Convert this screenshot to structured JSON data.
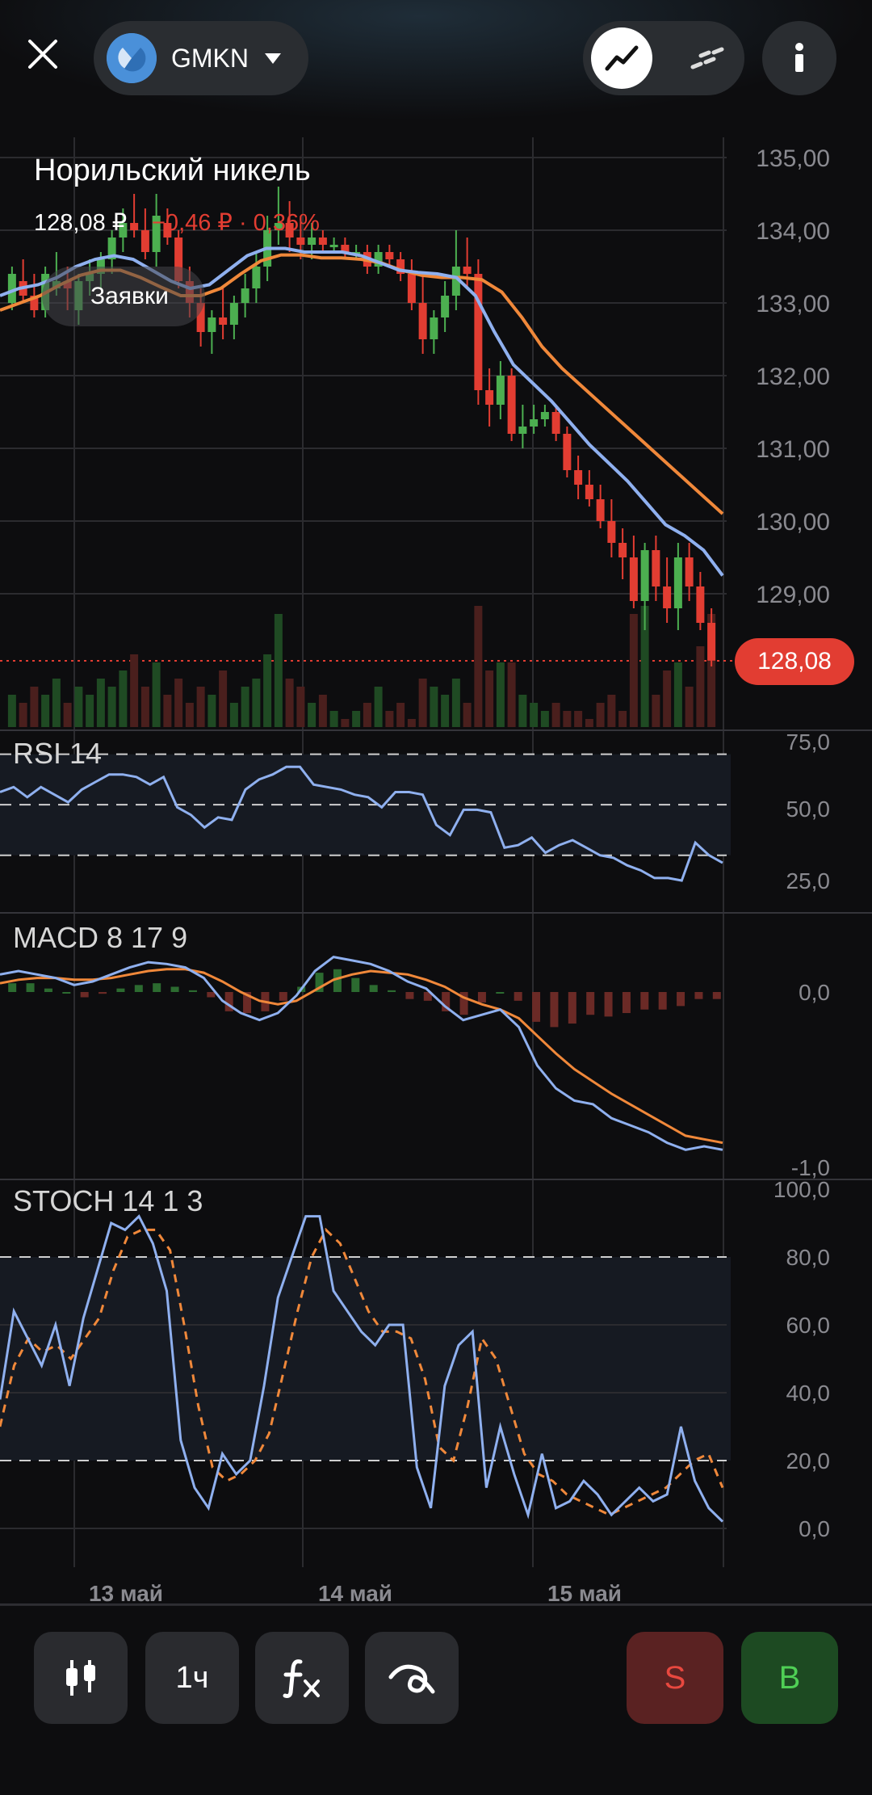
{
  "header": {
    "ticker": "GMKN",
    "icons": {
      "close": "close-icon",
      "logo": "nornickel-logo",
      "caret": "caret-down-icon",
      "line_mode": "line-chart-icon",
      "dash_mode": "dashed-chart-icon",
      "info": "info-icon"
    }
  },
  "instrument": {
    "name": "Норильский никель",
    "price": "128,08 ₽",
    "change": "−0,46 ₽ · 0,36%",
    "orders_label": "Заявки",
    "last_price_badge": "128,08"
  },
  "colors": {
    "up": "#4caf50",
    "down": "#e23d32",
    "ma_fast": "#8fb0ef",
    "ma_slow": "#f0883a",
    "background": "#0d0d0f"
  },
  "panes": {
    "rsi_label": "RSI 14",
    "macd_label": "MACD 8 17 9",
    "stoch_label": "STOCH 14 1 3"
  },
  "chart_data": {
    "type": "candlestick",
    "candles": [
      [
        133.0,
        133.5,
        132.9,
        133.4
      ],
      [
        133.3,
        133.6,
        133.0,
        133.1
      ],
      [
        133.1,
        133.4,
        132.8,
        132.9
      ],
      [
        132.9,
        133.5,
        132.8,
        133.4
      ],
      [
        133.2,
        133.7,
        133.1,
        133.3
      ],
      [
        133.3,
        133.5,
        132.9,
        133.2
      ],
      [
        132.9,
        133.4,
        132.7,
        133.3
      ],
      [
        133.3,
        133.6,
        133.1,
        133.4
      ],
      [
        133.4,
        133.7,
        133.2,
        133.6
      ],
      [
        133.6,
        134.0,
        133.4,
        133.9
      ],
      [
        133.9,
        134.3,
        133.7,
        134.1
      ],
      [
        134.1,
        134.5,
        133.9,
        134.0
      ],
      [
        134.0,
        134.3,
        133.6,
        133.7
      ],
      [
        133.7,
        134.5,
        133.5,
        134.2
      ],
      [
        134.1,
        134.3,
        133.8,
        133.9
      ],
      [
        133.9,
        134.0,
        133.2,
        133.3
      ],
      [
        133.3,
        133.5,
        132.8,
        133.0
      ],
      [
        133.0,
        133.2,
        132.4,
        132.6
      ],
      [
        132.6,
        132.9,
        132.3,
        132.8
      ],
      [
        132.8,
        133.2,
        132.5,
        132.7
      ],
      [
        132.7,
        133.1,
        132.5,
        133.0
      ],
      [
        133.0,
        133.4,
        132.8,
        133.2
      ],
      [
        133.2,
        133.7,
        133.0,
        133.5
      ],
      [
        133.5,
        134.2,
        133.3,
        134.0
      ],
      [
        134.0,
        134.6,
        133.8,
        134.1
      ],
      [
        134.1,
        134.4,
        133.7,
        133.9
      ],
      [
        133.9,
        134.2,
        133.6,
        133.8
      ],
      [
        133.8,
        134.1,
        133.6,
        133.9
      ],
      [
        133.9,
        134.0,
        133.7,
        133.8
      ],
      [
        133.8,
        133.9,
        133.7,
        133.8
      ],
      [
        133.8,
        133.9,
        133.6,
        133.7
      ],
      [
        133.7,
        133.8,
        133.6,
        133.7
      ],
      [
        133.7,
        133.8,
        133.4,
        133.5
      ],
      [
        133.5,
        133.8,
        133.4,
        133.7
      ],
      [
        133.7,
        133.8,
        133.5,
        133.6
      ],
      [
        133.6,
        133.7,
        133.3,
        133.4
      ],
      [
        133.4,
        133.6,
        132.9,
        133.0
      ],
      [
        133.0,
        133.4,
        132.3,
        132.5
      ],
      [
        132.5,
        132.9,
        132.3,
        132.8
      ],
      [
        132.8,
        133.3,
        132.6,
        133.1
      ],
      [
        133.1,
        134.0,
        132.9,
        133.5
      ],
      [
        133.5,
        133.9,
        133.2,
        133.4
      ],
      [
        133.4,
        133.6,
        131.6,
        131.8
      ],
      [
        131.8,
        132.1,
        131.3,
        131.6
      ],
      [
        131.6,
        132.2,
        131.4,
        132.0
      ],
      [
        132.0,
        132.1,
        131.1,
        131.2
      ],
      [
        131.2,
        131.6,
        131.0,
        131.3
      ],
      [
        131.3,
        131.6,
        131.2,
        131.4
      ],
      [
        131.4,
        131.6,
        131.3,
        131.5
      ],
      [
        131.5,
        131.6,
        131.1,
        131.2
      ],
      [
        131.2,
        131.3,
        130.6,
        130.7
      ],
      [
        130.7,
        130.9,
        130.3,
        130.5
      ],
      [
        130.5,
        130.7,
        130.2,
        130.3
      ],
      [
        130.3,
        130.5,
        129.9,
        130.0
      ],
      [
        130.0,
        130.3,
        129.5,
        129.7
      ],
      [
        129.7,
        129.9,
        129.2,
        129.5
      ],
      [
        129.5,
        129.8,
        128.8,
        128.9
      ],
      [
        128.9,
        129.7,
        128.5,
        129.6
      ],
      [
        129.6,
        129.8,
        128.9,
        129.1
      ],
      [
        129.1,
        129.5,
        128.6,
        128.8
      ],
      [
        128.8,
        129.7,
        128.5,
        129.5
      ],
      [
        129.5,
        129.7,
        128.9,
        129.1
      ],
      [
        129.1,
        129.3,
        128.5,
        128.6
      ],
      [
        128.6,
        128.8,
        128.0,
        128.08
      ]
    ],
    "volume": [
      4,
      3,
      5,
      4,
      6,
      3,
      5,
      4,
      6,
      5,
      7,
      9,
      5,
      8,
      4,
      6,
      3,
      5,
      4,
      7,
      3,
      5,
      6,
      9,
      14,
      6,
      5,
      3,
      4,
      2,
      1,
      2,
      3,
      5,
      2,
      3,
      1,
      6,
      5,
      4,
      6,
      3,
      15,
      7,
      8,
      8,
      4,
      3,
      2,
      3,
      2,
      2,
      1,
      3,
      4,
      2,
      14,
      15,
      4,
      7,
      8,
      5,
      10,
      14
    ],
    "ma_fast": [
      133.1,
      133.2,
      133.25,
      133.35,
      133.5,
      133.6,
      133.65,
      133.6,
      133.45,
      133.3,
      133.2,
      133.25,
      133.45,
      133.65,
      133.75,
      133.75,
      133.7,
      133.7,
      133.7,
      133.65,
      133.55,
      133.45,
      133.42,
      133.4,
      133.35,
      133.1,
      132.6,
      132.15,
      131.9,
      131.65,
      131.35,
      131.05,
      130.8,
      130.55,
      130.25,
      129.95,
      129.8,
      129.6,
      129.25
    ],
    "ma_slow": [
      132.9,
      133.0,
      133.1,
      133.25,
      133.38,
      133.45,
      133.45,
      133.35,
      133.22,
      133.1,
      133.1,
      133.2,
      133.4,
      133.58,
      133.66,
      133.66,
      133.62,
      133.62,
      133.6,
      133.55,
      133.45,
      133.38,
      133.35,
      133.35,
      133.32,
      133.15,
      132.8,
      132.4,
      132.1,
      131.85,
      131.6,
      131.35,
      131.1,
      130.85,
      130.6,
      130.35,
      130.1
    ],
    "price_axis": {
      "ticks": [
        "135,00",
        "134,00",
        "133,00",
        "132,00",
        "131,00",
        "130,00",
        "129,00"
      ],
      "ylim": [
        128.0,
        135.0
      ]
    },
    "x_labels": [
      "13 май",
      "14 май",
      "15 май"
    ],
    "rsi": {
      "values": [
        55,
        57,
        53,
        57,
        54,
        51,
        56,
        59,
        62,
        62,
        61,
        58,
        61,
        49,
        46,
        41,
        45,
        44,
        56,
        60,
        62,
        65,
        65,
        58,
        57,
        56,
        54,
        53,
        49,
        55,
        55,
        54,
        42,
        38,
        48,
        48,
        47,
        33,
        34,
        37,
        31,
        34,
        36,
        33,
        30,
        29,
        26,
        24,
        21,
        21,
        20,
        35,
        30,
        27
      ],
      "ticks": [
        "75,0",
        "50,0",
        "25,0"
      ],
      "levels": [
        70,
        50,
        30
      ],
      "ylim": [
        20,
        75
      ]
    },
    "macd": {
      "line": [
        0.1,
        0.12,
        0.1,
        0.08,
        0.04,
        0.06,
        0.1,
        0.14,
        0.17,
        0.16,
        0.14,
        0.08,
        -0.05,
        -0.12,
        -0.16,
        -0.12,
        -0.02,
        0.12,
        0.2,
        0.18,
        0.16,
        0.12,
        0.06,
        0.02,
        -0.08,
        -0.16,
        -0.13,
        -0.1,
        -0.2,
        -0.42,
        -0.55,
        -0.62,
        -0.64,
        -0.72,
        -0.76,
        -0.8,
        -0.86,
        -0.9,
        -0.88,
        -0.9
      ],
      "signal": [
        0.05,
        0.07,
        0.08,
        0.08,
        0.07,
        0.07,
        0.08,
        0.1,
        0.12,
        0.13,
        0.13,
        0.11,
        0.06,
        0.0,
        -0.05,
        -0.07,
        -0.05,
        0.01,
        0.07,
        0.1,
        0.12,
        0.11,
        0.1,
        0.07,
        0.03,
        -0.03,
        -0.07,
        -0.1,
        -0.15,
        -0.25,
        -0.35,
        -0.44,
        -0.51,
        -0.58,
        -0.64,
        -0.7,
        -0.76,
        -0.82,
        -0.84,
        -0.86
      ],
      "ticks": [
        "0,0",
        "-1,0"
      ],
      "ylim": [
        -1.0,
        0.2
      ]
    },
    "stoch": {
      "k": [
        38,
        64,
        56,
        48,
        60,
        42,
        62,
        76,
        90,
        88,
        92,
        84,
        70,
        26,
        12,
        6,
        22,
        16,
        20,
        42,
        68,
        80,
        92,
        92,
        70,
        64,
        58,
        54,
        60,
        60,
        18,
        6,
        42,
        54,
        58,
        12,
        30,
        16,
        4,
        22,
        6,
        8,
        14,
        10,
        4,
        8,
        12,
        8,
        10,
        30,
        14,
        6,
        2
      ],
      "d": [
        30,
        48,
        56,
        52,
        54,
        50,
        56,
        62,
        76,
        86,
        88,
        88,
        82,
        60,
        36,
        18,
        14,
        16,
        20,
        28,
        46,
        64,
        80,
        88,
        84,
        74,
        64,
        58,
        58,
        56,
        44,
        24,
        20,
        36,
        56,
        50,
        36,
        22,
        16,
        14,
        10,
        8,
        6,
        4,
        6,
        8,
        10,
        12,
        16,
        20,
        22,
        12
      ],
      "ticks": [
        "100,0",
        "80,0",
        "60,0",
        "40,0",
        "20,0",
        "0,0"
      ],
      "levels": [
        80,
        20
      ],
      "ylim": [
        0,
        100
      ]
    }
  },
  "toolbar": {
    "candles_icon": "candlestick-icon",
    "interval_label": "1ч",
    "indicators_icon": "fx-icon",
    "draw_icon": "draw-curve-icon",
    "sell_label": "S",
    "buy_label": "B"
  }
}
